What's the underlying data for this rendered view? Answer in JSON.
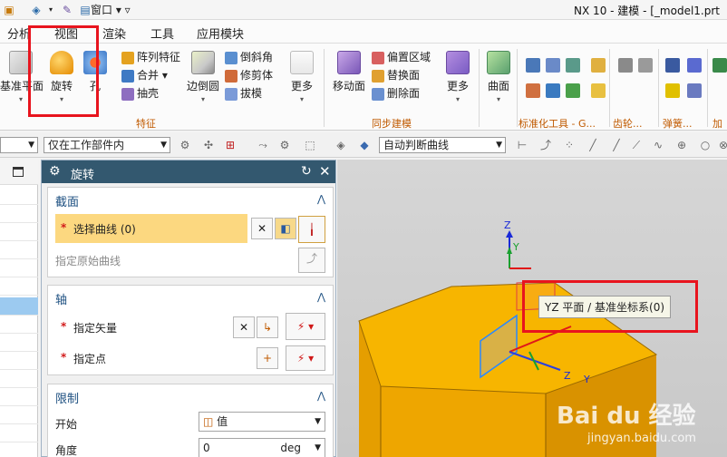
{
  "window": {
    "title": "NX 10 - 建模 - [_model1.prt",
    "window_menu": "窗口"
  },
  "menubar": {
    "items": [
      "分析",
      "视图",
      "渲染",
      "工具",
      "应用模块"
    ]
  },
  "ribbon": {
    "datum_plane": "基准平面",
    "revolve": "旋转",
    "hole": "孔",
    "pattern_feature": "阵列特征",
    "unite": "合并",
    "shell": "抽壳",
    "edge_blend": "边倒圆",
    "chamfer": "倒斜角",
    "trim_body": "修剪体",
    "draft": "拔模",
    "more1": "更多",
    "group_feature": "特征",
    "move_face": "移动面",
    "offset_region": "偏置区域",
    "replace_face": "替换面",
    "delete_face": "删除面",
    "more2": "更多",
    "group_sync": "同步建模",
    "surface": "曲面",
    "group_std": "标准化工具 - G...",
    "group_gear": "齿轮...",
    "group_spring": "弹簧...",
    "group_add": "加工"
  },
  "selection_bar": {
    "filter_value": "",
    "scope_value": "仅在工作部件内",
    "curve_rule": "自动判断曲线"
  },
  "dialog": {
    "title": "旋转",
    "section": {
      "title": "截面",
      "select_curve_label": "选择曲线 (0)",
      "origin_curve_label": "指定原始曲线"
    },
    "axis": {
      "title": "轴",
      "vector_label": "指定矢量",
      "point_label": "指定点"
    },
    "limits": {
      "title": "限制",
      "start_label": "开始",
      "start_value": "值",
      "angle_label": "角度",
      "angle_value": "0",
      "angle_unit": "deg"
    }
  },
  "viewport": {
    "tooltip": "YZ 平面 / 基准坐标系(0)",
    "axis_z_top": "Z",
    "axis_y_top": "Y",
    "axis_z_bottom": "Z",
    "axis_y_bottom": "Y",
    "watermark_brand": "Bai du 经验",
    "watermark_url": "jingyan.baidu.com"
  },
  "colors": {
    "dialog_header": "#33586f",
    "selected_row": "#fcd880",
    "solid_top": "#f7b500",
    "solid_side": "#eea600",
    "highlight": "#e8141e"
  }
}
